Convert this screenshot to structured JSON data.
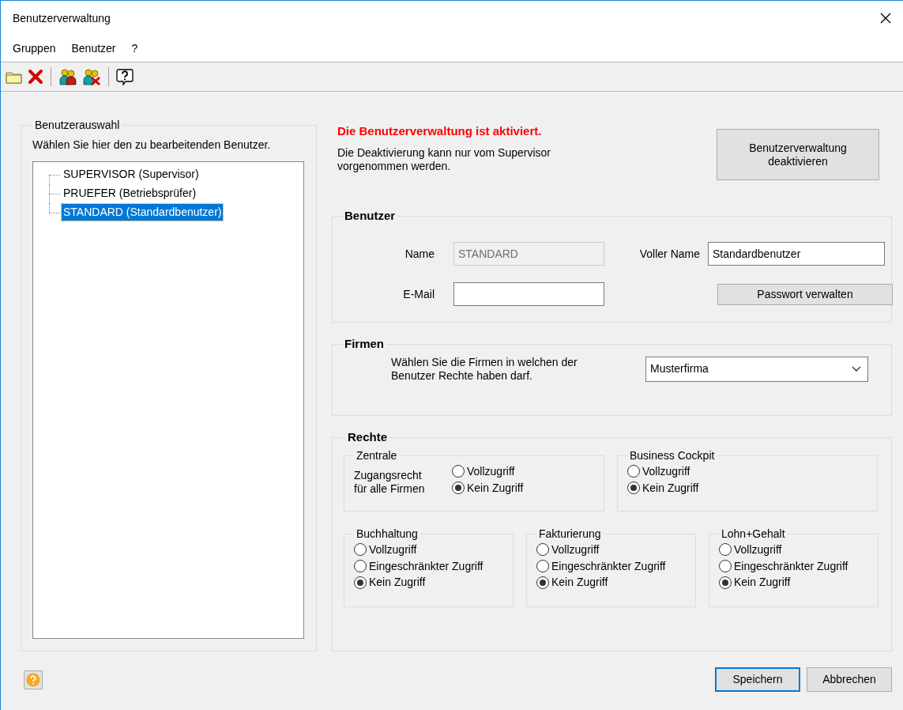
{
  "window": {
    "title": "Benutzerverwaltung"
  },
  "menu": [
    {
      "label": "Gruppen"
    },
    {
      "label": "Benutzer"
    },
    {
      "label": "?"
    }
  ],
  "toolbar": [
    {
      "kind": "folder"
    },
    {
      "kind": "delete"
    },
    {
      "kind": "separator"
    },
    {
      "kind": "users"
    },
    {
      "kind": "users-delete"
    },
    {
      "kind": "separator"
    },
    {
      "kind": "help"
    }
  ],
  "user_selection": {
    "legend": "Benutzerauswahl",
    "hint": "Wählen Sie hier den zu bearbeitenden Benutzer.",
    "tree": [
      {
        "label": "SUPERVISOR (Supervisor)",
        "selected": false
      },
      {
        "label": "PRUEFER (Betriebsprüfer)",
        "selected": false
      },
      {
        "label": "STANDARD (Standardbenutzer)",
        "selected": true
      }
    ]
  },
  "status": {
    "message": "Die Benutzerverwaltung ist aktiviert.",
    "note": "Die Deaktivierung kann nur vom Supervisor vorgenommen werden.",
    "button": {
      "label": "Benutzerverwaltung deaktivieren"
    }
  },
  "user": {
    "legend": "Benutzer",
    "name": {
      "label": "Name",
      "value": "STANDARD",
      "disabled": true
    },
    "full_name": {
      "label": "Voller Name",
      "value": "Standardbenutzer",
      "disabled": false
    },
    "email": {
      "label": "E-Mail",
      "disabled": false
    },
    "password_button": {
      "label": "Passwort verwalten"
    }
  },
  "companies": {
    "legend": "Firmen",
    "hint": "Wählen Sie die Firmen in welchen der Benutzer Rechte haben darf.",
    "value": "Musterfirma"
  },
  "rights": {
    "legend": "Rechte",
    "groups": [
      {
        "title": "Zentrale",
        "note": "Zugangsrecht für alle Firmen",
        "options": [
          {
            "label": "Vollzugriff",
            "selected": false
          },
          {
            "label": "Kein Zugriff",
            "selected": true
          }
        ]
      },
      {
        "title": "Business Cockpit",
        "options": [
          {
            "label": "Vollzugriff",
            "selected": false
          },
          {
            "label": "Kein Zugriff",
            "selected": true
          }
        ]
      },
      {
        "title": "Buchhaltung",
        "options": [
          {
            "label": "Vollzugriff",
            "selected": false
          },
          {
            "label": "Eingeschränkter Zugriff",
            "selected": false
          },
          {
            "label": "Kein Zugriff",
            "selected": true
          }
        ]
      },
      {
        "title": "Fakturierung",
        "options": [
          {
            "label": "Vollzugriff",
            "selected": false
          },
          {
            "label": "Eingeschränkter Zugriff",
            "selected": false
          },
          {
            "label": "Kein Zugriff",
            "selected": true
          }
        ]
      },
      {
        "title": "Lohn+Gehalt",
        "options": [
          {
            "label": "Vollzugriff",
            "selected": false
          },
          {
            "label": "Eingeschränkter Zugriff",
            "selected": false
          },
          {
            "label": "Kein Zugriff",
            "selected": true
          }
        ]
      }
    ]
  },
  "footer": {
    "buttons": [
      {
        "label": "Speichern",
        "default": true
      },
      {
        "label": "Abbrechen",
        "default": false
      }
    ]
  }
}
